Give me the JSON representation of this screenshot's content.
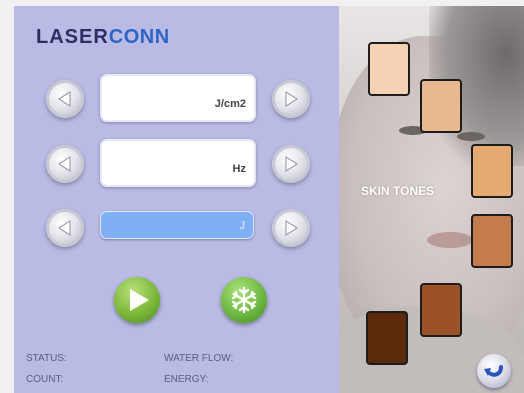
{
  "brand": {
    "logo_part1": "LASER",
    "logo_part2": "CONN"
  },
  "controls": [
    {
      "unit": "J/cm2",
      "value": ""
    },
    {
      "unit": "Hz",
      "value": ""
    },
    {
      "unit": "J",
      "value": ""
    }
  ],
  "icons": {
    "decrease": "arrow-left-icon",
    "increase": "arrow-right-icon",
    "start": "play-icon",
    "cooling": "snowflake-icon",
    "back": "back-arrow-icon"
  },
  "status": {
    "status_label": "STATUS:",
    "count_label": "COUNT:",
    "water_flow_label": "WATER FLOW:",
    "energy_label": "ENERGY:"
  },
  "skin": {
    "label": "SKIN TONES",
    "tones": [
      "#f6d2b4",
      "#e9b88f",
      "#e6ab72",
      "#c47b4e",
      "#9b5226",
      "#5a2a0b"
    ]
  },
  "colors": {
    "panel": "#b9bbe4",
    "accent_blue": "#7fb0f3",
    "green_button": "#7db83a"
  }
}
